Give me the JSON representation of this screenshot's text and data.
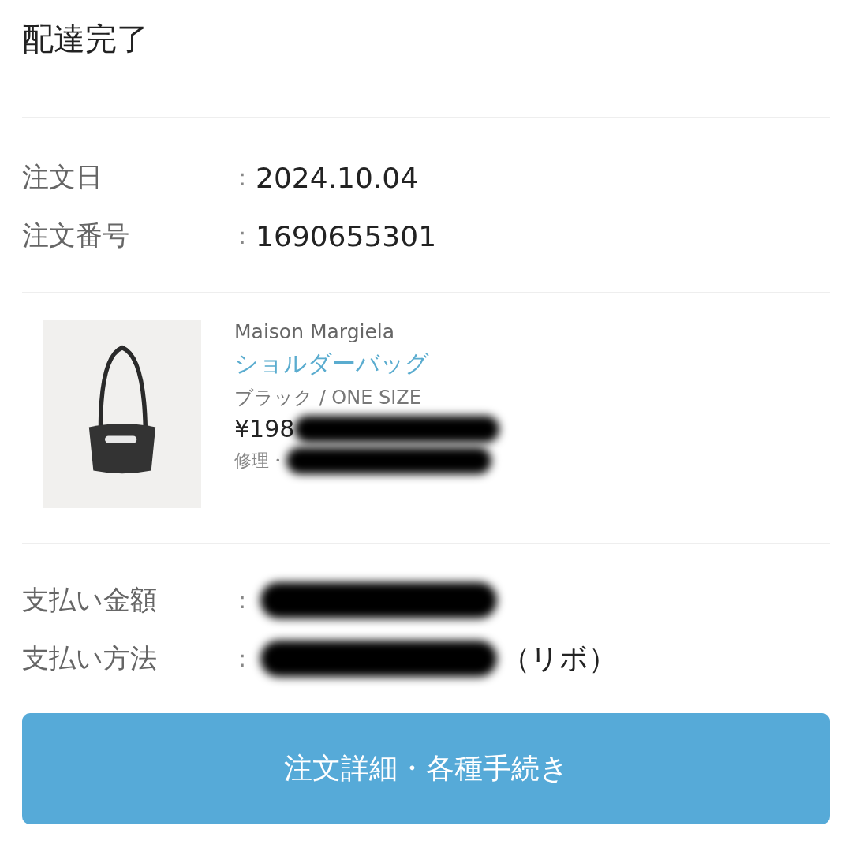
{
  "status_title": "配達完了",
  "order_info": [
    {
      "label": "注文日",
      "separator": "：",
      "value": "2024.10.04"
    },
    {
      "label": "注文番号",
      "separator": "：",
      "value": "1690655301"
    }
  ],
  "product": {
    "brand": "Maison Margiela",
    "name": "ショルダーバッグ",
    "variant": "ブラック / ONE SIZE",
    "price": {
      "value": "¥198",
      "redacted": true
    },
    "note": {
      "value": "修理・",
      "redacted": true
    }
  },
  "payment": [
    {
      "label": "支払い金額",
      "separator": "：",
      "redacted": true
    },
    {
      "label": "支払い方法",
      "separator": "：",
      "redacted": true,
      "tail": "（リボ）"
    }
  ],
  "button": {
    "label": "注文詳細・各種手続き"
  }
}
